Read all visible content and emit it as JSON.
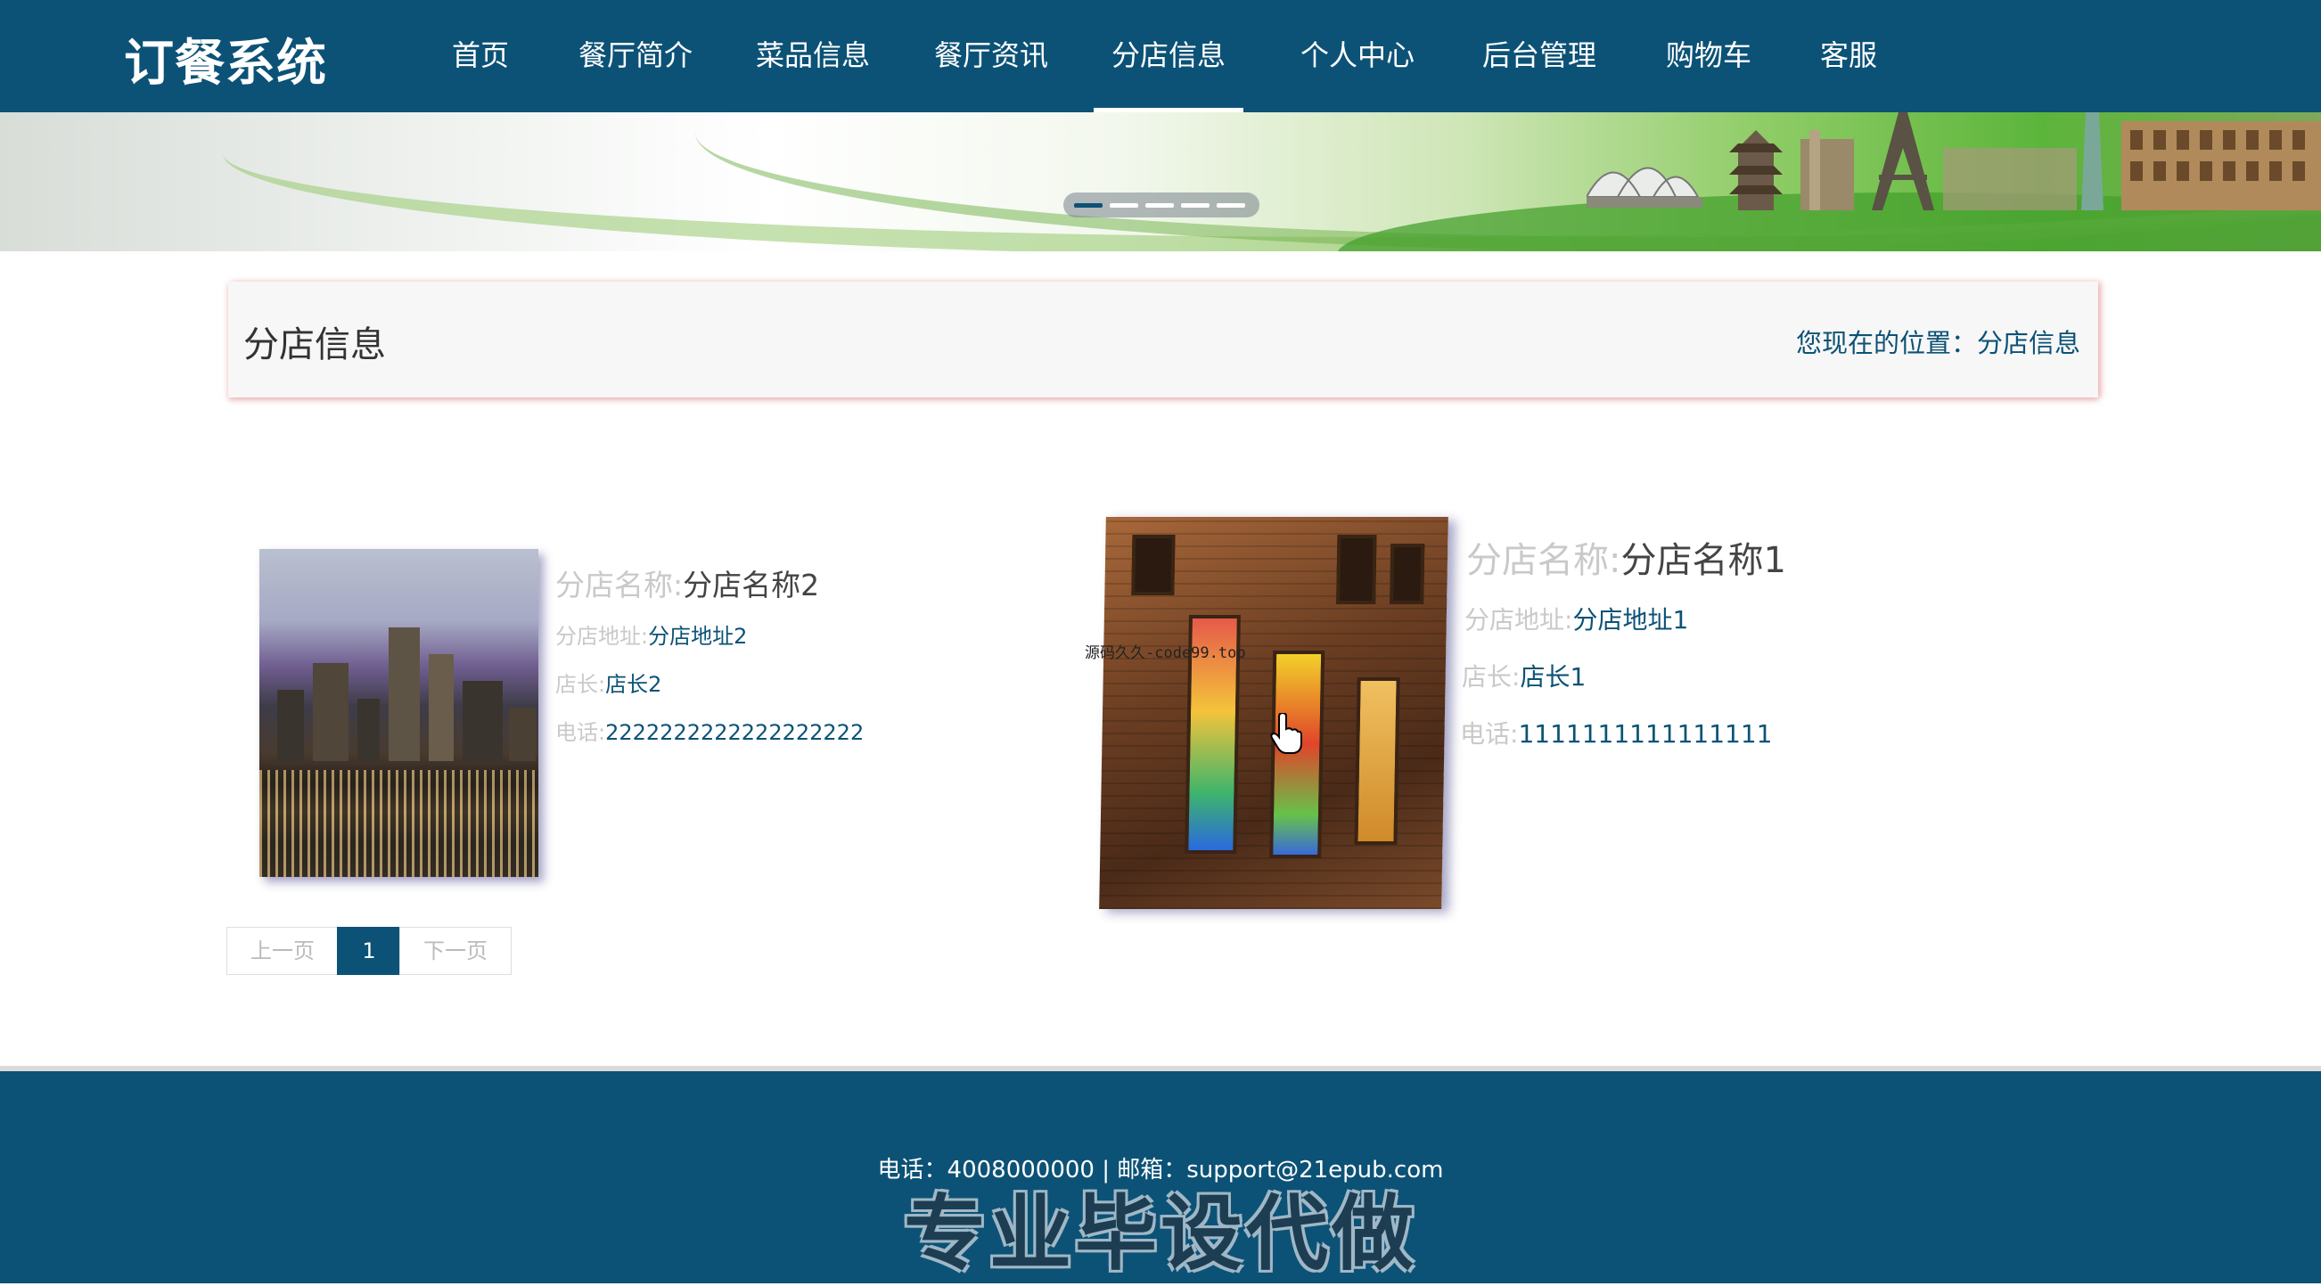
{
  "header": {
    "logo": "订餐系统",
    "nav": [
      "首页",
      "餐厅简介",
      "菜品信息",
      "餐厅资讯",
      "分店信息",
      "个人中心",
      "后台管理",
      "购物车",
      "客服"
    ],
    "active_index": 4
  },
  "banner": {
    "slides": 5,
    "active_slide": 0
  },
  "titlebar": {
    "title": "分店信息",
    "breadcrumb_prefix": "您现在的位置：",
    "breadcrumb_current": "分店信息"
  },
  "branches": [
    {
      "name_label": "分店名称:",
      "name": "分店名称2",
      "address_label": "分店地址:",
      "address": "分店地址2",
      "manager_label": "店长:",
      "manager": "店长2",
      "phone_label": "电话:",
      "phone": "2222222222222222222"
    },
    {
      "name_label": "分店名称:",
      "name": "分店名称1",
      "address_label": "分店地址:",
      "address": "分店地址1",
      "manager_label": "店长:",
      "manager": "店长1",
      "phone_label": "电话:",
      "phone": "1111111111111111"
    }
  ],
  "watermark": "源码久久-code99.top",
  "pagination": {
    "prev": "上一页",
    "current": "1",
    "next": "下一页"
  },
  "footer": {
    "contact": "电话：4008000000 | 邮箱：support@21epub.com",
    "promo": "专业毕设代做"
  },
  "colors": {
    "primary": "#0c5276",
    "label_gray": "#c9c9c9"
  }
}
